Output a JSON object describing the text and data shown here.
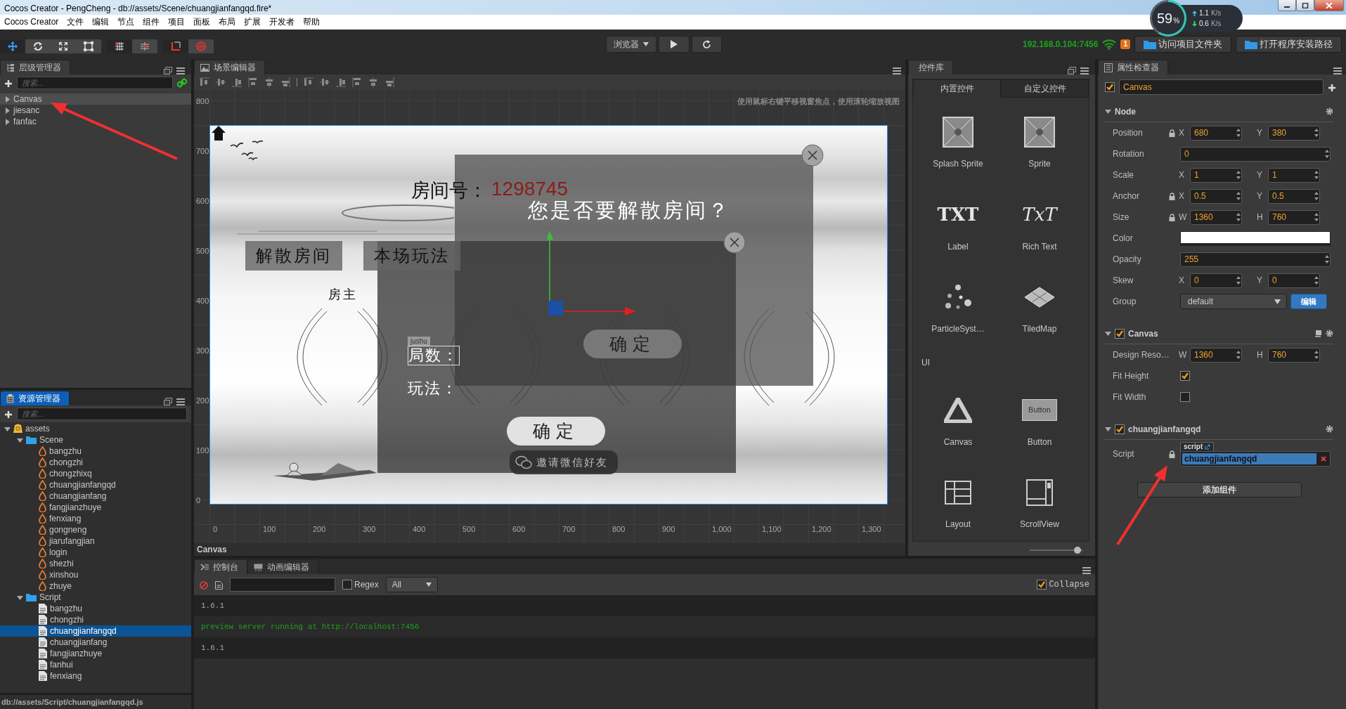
{
  "window": {
    "title": "Cocos Creator - PengCheng - db://assets/Scene/chuangjianfangqd.fire*"
  },
  "menu": [
    "Cocos Creator",
    "文件",
    "编辑",
    "节点",
    "组件",
    "项目",
    "面板",
    "布局",
    "扩展",
    "开发者",
    "帮助"
  ],
  "toolbar": {
    "tool_groups": [
      [
        {
          "kind": "move",
          "selected": true
        },
        {
          "kind": "rotate",
          "selected": false
        },
        {
          "kind": "scale",
          "selected": false
        },
        {
          "kind": "rect",
          "selected": false
        }
      ],
      [
        {
          "kind": "pivot",
          "selected": true
        },
        {
          "kind": "grid",
          "selected": false
        }
      ],
      [
        {
          "kind": "corner",
          "selected": true
        },
        {
          "kind": "globe",
          "selected": false
        }
      ]
    ],
    "platform": "浏览器",
    "ip": "192.168.0.104:7456",
    "notification_count": "1",
    "buttons": [
      "访问项目文件夹",
      "打开程序安装路径"
    ]
  },
  "net_monitor": {
    "percent": "59",
    "percent_sign": "%",
    "upload": "1.1",
    "upload_unit": "K/s",
    "download": "0.6",
    "download_unit": "K/s"
  },
  "hierarchy": {
    "title": "层级管理器",
    "search": {
      "placeholder": "搜索..."
    },
    "nodes": [
      {
        "name": "Canvas",
        "expanded": false,
        "selected": true
      },
      {
        "name": "jiesanc",
        "expanded": false,
        "selected": false
      },
      {
        "name": "fanfac",
        "expanded": false,
        "selected": false
      }
    ]
  },
  "assets": {
    "title": "资源管理器",
    "search": {
      "placeholder": "搜索..."
    },
    "tree": [
      {
        "name": "assets",
        "kind": "root",
        "expanded": true,
        "selected": false,
        "children": [
          {
            "name": "Scene",
            "kind": "folder",
            "expanded": true,
            "selected": false,
            "children": [
              {
                "name": "bangzhu",
                "kind": "scene",
                "selected": false
              },
              {
                "name": "chongzhi",
                "kind": "scene",
                "selected": false
              },
              {
                "name": "chongzhixq",
                "kind": "scene",
                "selected": false
              },
              {
                "name": "chuangjianfangqd",
                "kind": "scene",
                "selected": false
              },
              {
                "name": "chuangjianfang",
                "kind": "scene",
                "selected": false
              },
              {
                "name": "fangjianzhuye",
                "kind": "scene",
                "selected": false
              },
              {
                "name": "fenxiang",
                "kind": "scene",
                "selected": false
              },
              {
                "name": "gongneng",
                "kind": "scene",
                "selected": false
              },
              {
                "name": "jiarufangjian",
                "kind": "scene",
                "selected": false
              },
              {
                "name": "login",
                "kind": "scene",
                "selected": false
              },
              {
                "name": "shezhi",
                "kind": "scene",
                "selected": false
              },
              {
                "name": "xinshou",
                "kind": "scene",
                "selected": false
              },
              {
                "name": "zhuye",
                "kind": "scene",
                "selected": false
              }
            ]
          },
          {
            "name": "Script",
            "kind": "folder",
            "expanded": true,
            "selected": false,
            "children": [
              {
                "name": "bangzhu",
                "kind": "script",
                "selected": false
              },
              {
                "name": "chongzhi",
                "kind": "script",
                "selected": false
              },
              {
                "name": "chuangjianfangqd",
                "kind": "script",
                "selected": true
              },
              {
                "name": "chuangjianfang",
                "kind": "script",
                "selected": false
              },
              {
                "name": "fangjianzhuye",
                "kind": "script",
                "selected": false
              },
              {
                "name": "fanhui",
                "kind": "script",
                "selected": false
              },
              {
                "name": "fenxiang",
                "kind": "script",
                "selected": false
              }
            ]
          }
        ]
      }
    ],
    "status": "db://assets/Script/chuangjianfangqd.js"
  },
  "scene_editor": {
    "title": "场景编辑器",
    "hint": "使用鼠标右键平移视窗焦点，使用滚轮缩放视图",
    "y_ticks": [
      "800",
      "700",
      "600",
      "500",
      "400",
      "300",
      "200",
      "100",
      "0"
    ],
    "x_ticks": [
      "0",
      "100",
      "200",
      "300",
      "400",
      "500",
      "600",
      "700",
      "800",
      "900",
      "1,000",
      "1,100",
      "1,200",
      "1,300"
    ],
    "selected_node": "Canvas",
    "scene": {
      "room_label": "房间号：",
      "room_number": "1298745",
      "menu_buttons": [
        "解散房间",
        "本场玩法"
      ],
      "host_label": "房主",
      "node_tag": "jushu",
      "rounds_label": "局数：",
      "rules_label": "玩法：",
      "confirm": "确定",
      "invite": "邀请微信好友",
      "dialog": {
        "question": "您是否要解散房间？",
        "confirm": "确定"
      }
    }
  },
  "widget_library": {
    "title": "控件库",
    "tabs": [
      {
        "label": "内置控件",
        "selected": true
      },
      {
        "label": "自定义控件",
        "selected": false
      }
    ],
    "items": [
      {
        "kind": "splash-sprite",
        "label": "Splash Sprite"
      },
      {
        "kind": "sprite",
        "label": "Sprite"
      },
      {
        "kind": "label",
        "label": "Label",
        "icon_text": "TXT"
      },
      {
        "kind": "rich-text",
        "label": "Rich Text",
        "icon_text": "TxT"
      },
      {
        "kind": "particle",
        "label": "ParticleSyst…"
      },
      {
        "kind": "tiledmap",
        "label": "TiledMap"
      },
      {
        "kind": "section",
        "label": "UI"
      },
      {
        "kind": "canvas",
        "label": "Canvas"
      },
      {
        "kind": "button",
        "label": "Button",
        "icon_text": "Button"
      },
      {
        "kind": "layout",
        "label": "Layout"
      },
      {
        "kind": "scrollview",
        "label": "ScrollView"
      }
    ],
    "zoom": {
      "level": 0.9
    }
  },
  "inspector": {
    "title": "属性检查器",
    "node": {
      "enabled": true,
      "name": "Canvas"
    },
    "sections": [
      {
        "title": "Node",
        "expanded": true,
        "rows": [
          {
            "kind": "pair",
            "label": "Position",
            "locked": true,
            "fields": [
              {
                "axis": "X",
                "value": "680"
              },
              {
                "axis": "Y",
                "value": "380"
              }
            ]
          },
          {
            "kind": "number",
            "label": "Rotation",
            "value": "0"
          },
          {
            "kind": "pair",
            "label": "Scale",
            "locked": false,
            "fields": [
              {
                "axis": "X",
                "value": "1"
              },
              {
                "axis": "Y",
                "value": "1"
              }
            ]
          },
          {
            "kind": "pair",
            "label": "Anchor",
            "locked": true,
            "fields": [
              {
                "axis": "X",
                "value": "0.5"
              },
              {
                "axis": "Y",
                "value": "0.5"
              }
            ]
          },
          {
            "kind": "pair",
            "label": "Size",
            "locked": true,
            "fields": [
              {
                "axis": "W",
                "value": "1360"
              },
              {
                "axis": "H",
                "value": "760"
              }
            ]
          },
          {
            "kind": "color",
            "label": "Color",
            "color": "#ffffff"
          },
          {
            "kind": "number",
            "label": "Opacity",
            "value": "255"
          },
          {
            "kind": "pair",
            "label": "Skew",
            "locked": false,
            "fields": [
              {
                "axis": "X",
                "value": "0"
              },
              {
                "axis": "Y",
                "value": "0"
              }
            ]
          },
          {
            "kind": "select",
            "label": "Group",
            "value": "default",
            "button": "编辑"
          }
        ]
      },
      {
        "title": "Canvas",
        "expanded": true,
        "enabled": true,
        "rows": [
          {
            "kind": "pair",
            "label": "Design Reso…",
            "locked": false,
            "fields": [
              {
                "axis": "W",
                "value": "1360"
              },
              {
                "axis": "H",
                "value": "760"
              }
            ]
          },
          {
            "kind": "check",
            "label": "Fit Height",
            "checked": true
          },
          {
            "kind": "check",
            "label": "Fit Width",
            "checked": false
          }
        ]
      },
      {
        "title": "chuangjianfangqd",
        "expanded": true,
        "enabled": true,
        "rows": [
          {
            "kind": "script",
            "label": "Script",
            "locked": true,
            "tag": "script",
            "value": "chuangjianfangqd"
          }
        ]
      }
    ],
    "add_button": "添加组件"
  },
  "console": {
    "tabs": [
      {
        "label": "控制台",
        "selected": true
      },
      {
        "label": "动画编辑器",
        "selected": false
      }
    ],
    "regex": {
      "label": "Regex",
      "checked": false
    },
    "level_filter": "All",
    "collapse": {
      "label": "Collapse",
      "checked": true
    },
    "logs": [
      {
        "kind": "log",
        "text": "1.6.1"
      },
      {
        "kind": "success",
        "text": "preview server running at http://localhost:7456"
      },
      {
        "kind": "log",
        "text": "1.6.1"
      }
    ]
  }
}
